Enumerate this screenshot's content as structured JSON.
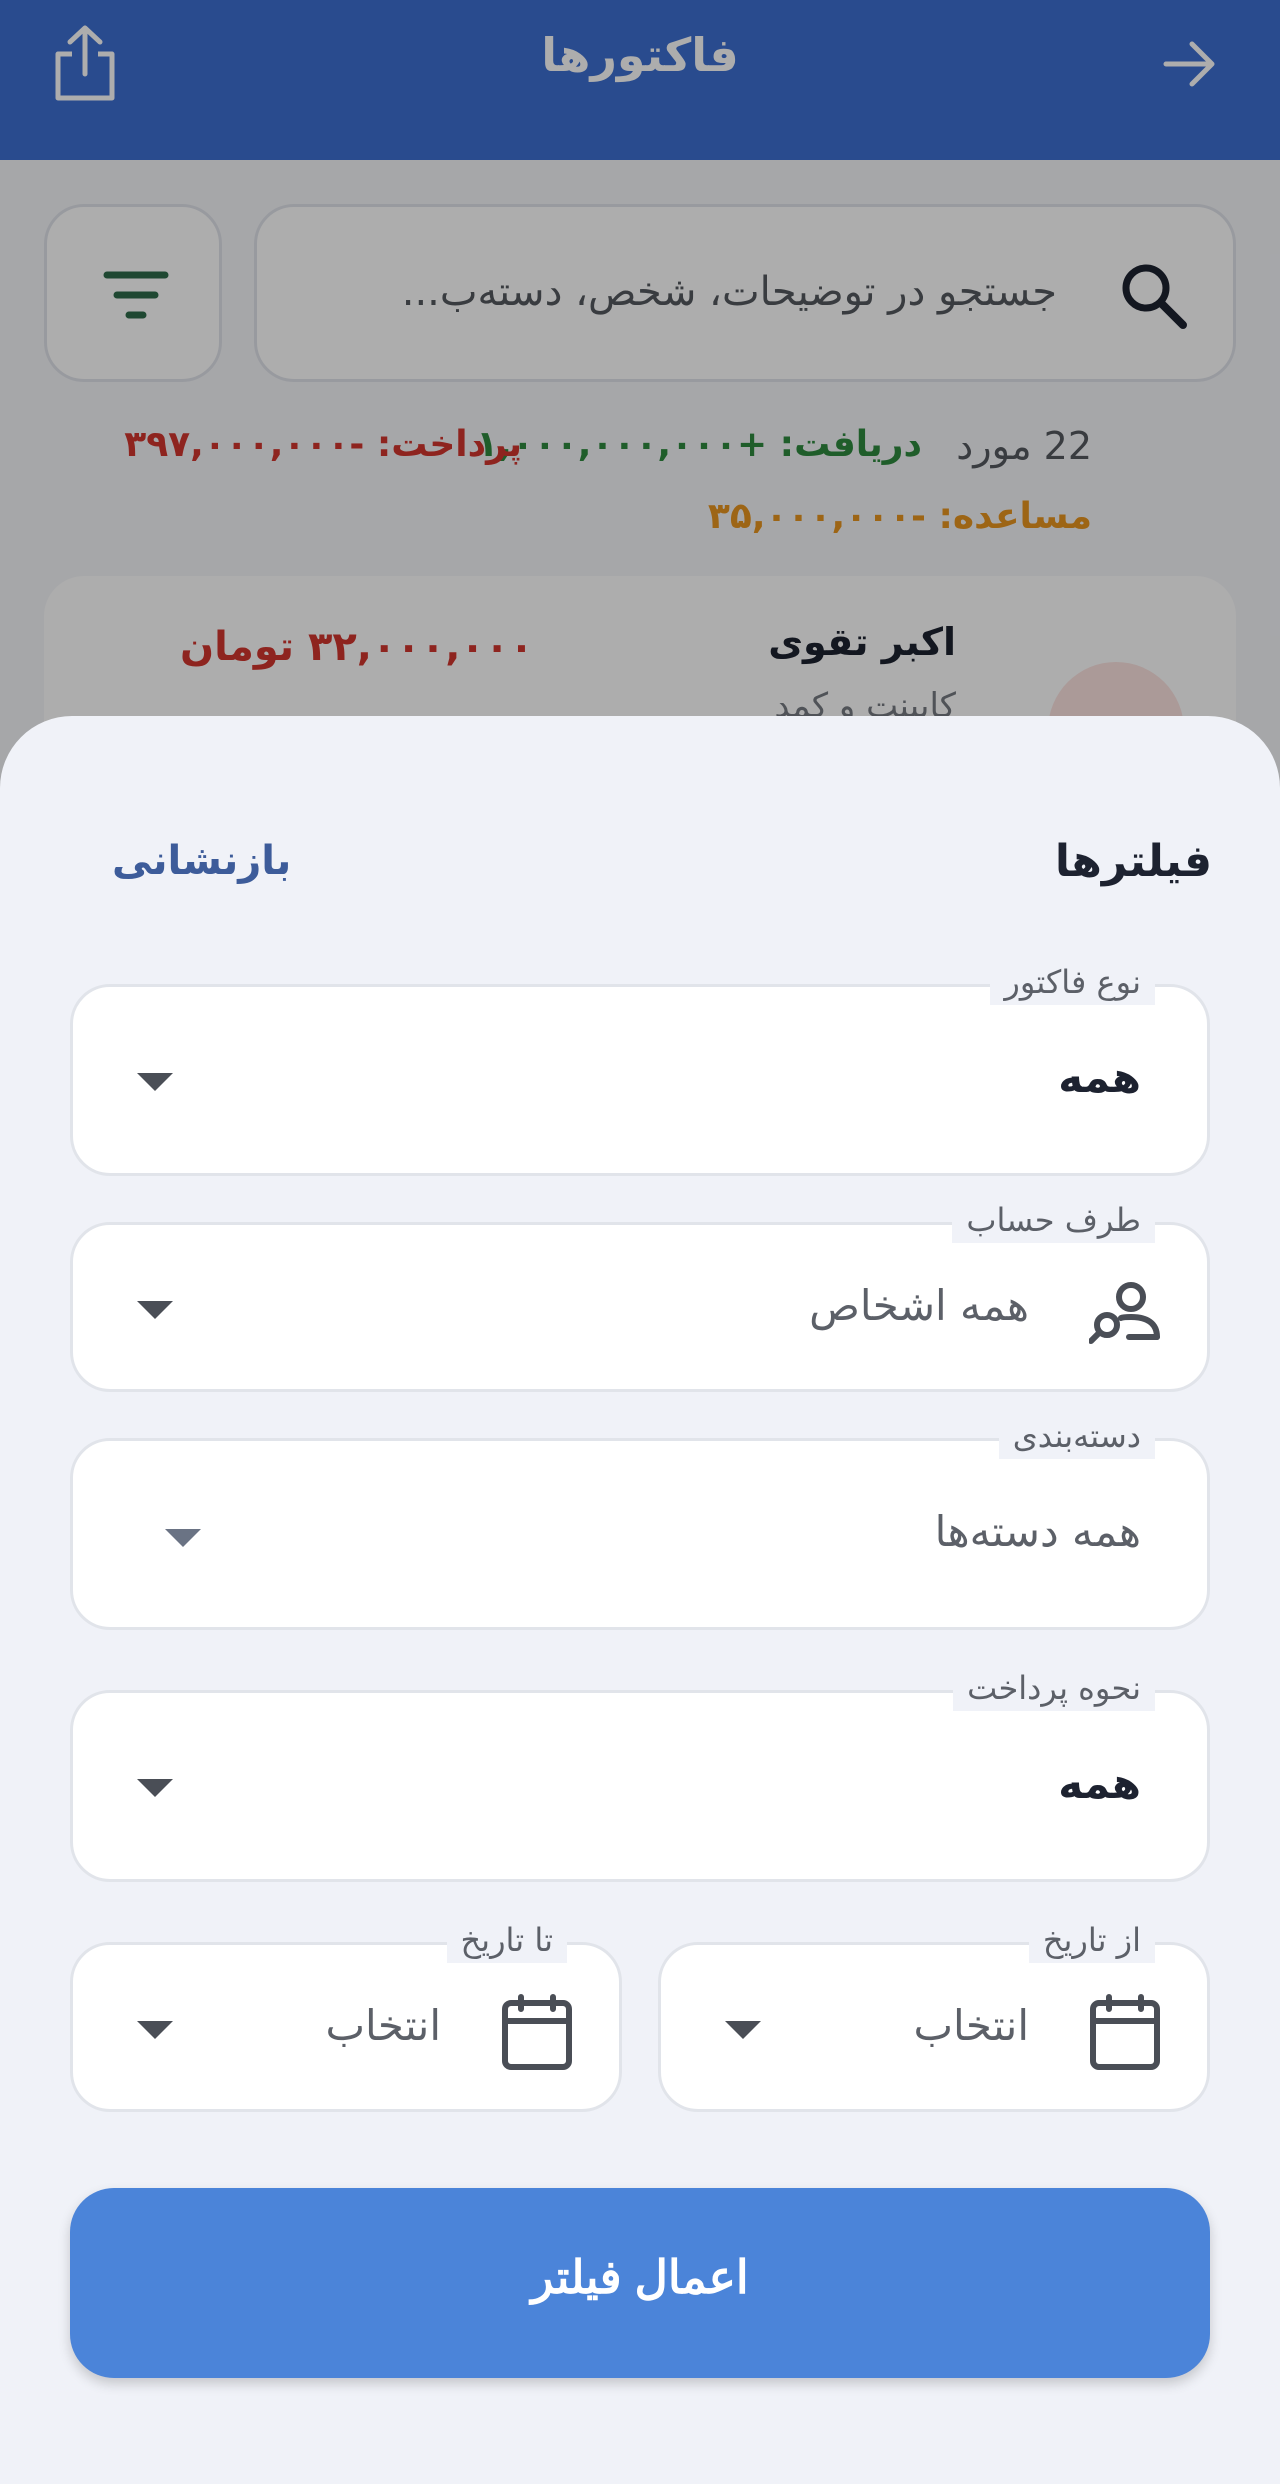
{
  "app_bar": {
    "title": "فاکتورها",
    "back_icon": "arrow-right-icon",
    "share_icon": "share-icon"
  },
  "search": {
    "placeholder": "جستجو در توضیحات، شخص، دسته‌ب...",
    "icon": "search-icon"
  },
  "filter_button": {
    "icon": "filter-icon"
  },
  "summary": {
    "count": "22 مورد",
    "receive": "دریافت: +۱,۰۰۰,۰۰۰,۰۰۰",
    "pay": "پرداخت: -۳۹۷,۰۰۰,۰۰۰",
    "advance": "مساعده: -۳۵,۰۰۰,۰۰۰"
  },
  "invoice": {
    "name": "اکبر تقوی",
    "subtitle": "کابینت و کمد",
    "amount": "۳۲,۰۰۰,۰۰۰ تومان"
  },
  "sheet": {
    "title": "فیلترها",
    "reset": "بازنشانی",
    "fields": {
      "invoice_type": {
        "label": "نوع فاکتور",
        "value": "همه"
      },
      "account_party": {
        "label": "طرف حساب",
        "value": "همه اشخاص"
      },
      "category": {
        "label": "دسته‌بندی",
        "value": "همه دسته‌ها"
      },
      "payment_method": {
        "label": "نحوه پرداخت",
        "value": "همه"
      },
      "from_date": {
        "label": "از تاریخ",
        "value": "انتخاب"
      },
      "to_date": {
        "label": "تا تاریخ",
        "value": "انتخاب"
      }
    },
    "apply": "اعمال فیلتر"
  },
  "colors": {
    "primary": "#3d6fd1",
    "apply_button": "#4b84d9",
    "receive": "#2e8a3e",
    "pay": "#d2362e",
    "advance": "#e8951f"
  }
}
